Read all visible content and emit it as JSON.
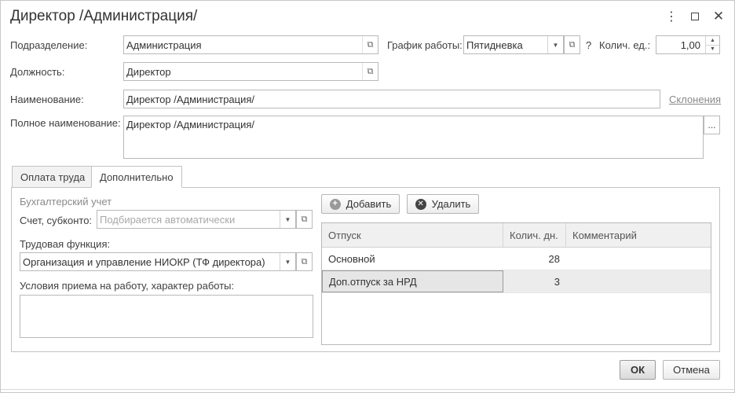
{
  "window": {
    "title": "Директор /Администрация/"
  },
  "form": {
    "division_label": "Подразделение:",
    "division_value": "Администрация",
    "schedule_label": "График работы:",
    "schedule_value": "Пятидневка",
    "help_mark": "?",
    "units_label": "Колич. ед.:",
    "units_value": "1,00",
    "position_label": "Должность:",
    "position_value": "Директор",
    "name_label": "Наименование:",
    "name_value": "Директор /Администрация/",
    "declension_link": "Склонения",
    "fullname_label": "Полное наименование:",
    "fullname_value": "Директор /Администрация/",
    "ellipsis_button": "..."
  },
  "tabs": [
    {
      "label": "Оплата труда"
    },
    {
      "label": "Дополнительно"
    }
  ],
  "additional": {
    "accounting_header": "Бухгалтерский учет",
    "account_label": "Счет, субконто:",
    "account_placeholder": "Подбирается автоматически",
    "labor_function_label": "Трудовая функция:",
    "labor_function_value": "Организация и управление НИОКР (ТФ директора)",
    "conditions_label": "Условия приема на работу, характер работы:",
    "add_button": "Добавить",
    "delete_button": "Удалить",
    "table": {
      "columns": [
        "Отпуск",
        "Колич. дн.",
        "Комментарий"
      ],
      "rows": [
        {
          "vacation": "Основной",
          "days": "28",
          "comment": ""
        },
        {
          "vacation": "Доп.отпуск за НРД",
          "days": "3",
          "comment": ""
        }
      ]
    }
  },
  "footer": {
    "ok_button": "ОК",
    "cancel_button": "Отмена"
  },
  "icons": {
    "more": "more-vertical-icon",
    "maximize": "maximize-icon",
    "close": "close-icon",
    "open": "open-form-icon",
    "dropdown": "dropdown-arrow-icon",
    "add": "plus-circle-icon",
    "delete": "x-circle-icon"
  }
}
